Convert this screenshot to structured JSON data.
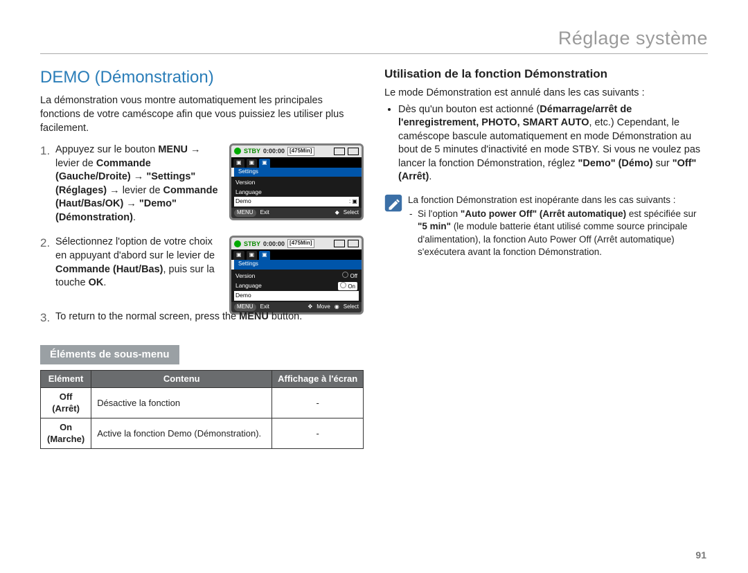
{
  "header": {
    "title": "Réglage système"
  },
  "page_number": "91",
  "left": {
    "section_title": "DEMO (Démonstration)",
    "intro": "La démonstration vous montre automatiquement les principales fonctions de votre caméscope afin que vous puissiez les utiliser plus facilement.",
    "step1": {
      "pre": "Appuyez sur le bouton ",
      "menu": "MENU",
      "a1": " → levier de ",
      "cmd1": "Commande (Gauche/Droite)",
      "a2": " → ",
      "settings": "\"Settings\" (Réglages)",
      "a3": " → levier de ",
      "cmd2": "Commande (Haut/Bas/OK)",
      "a4": " → ",
      "demo": "\"Demo\" (Démonstration)",
      "end": "."
    },
    "step2": {
      "l1": "Sélectionnez l'option de votre choix en appuyant d'abord sur le levier de ",
      "cmd": "Commande (Haut/Bas)",
      "l2": ", puis sur la touche ",
      "ok": "OK",
      "end": "."
    },
    "step3": {
      "l1": "To return to the normal screen, press the ",
      "menu": "MENU",
      "l2": " button."
    },
    "submenu_title": "Éléments de sous-menu",
    "table": {
      "headers": {
        "c1": "Elément",
        "c2": "Contenu",
        "c3": "Affichage à l'écran"
      },
      "rows": [
        {
          "c1a": "Off",
          "c1b": "(Arrêt)",
          "c2": "Désactive la fonction",
          "c3": "-"
        },
        {
          "c1a": "On",
          "c1b": "(Marche)",
          "c2": "Active la fonction Demo (Démonstration).",
          "c3": "-"
        }
      ]
    }
  },
  "right": {
    "h3": "Utilisation de la fonction Démonstration",
    "lead": "Le mode Démonstration est annulé dans les cas suivants :",
    "bullet": {
      "p1": "Dès qu'un bouton est actionné (",
      "b1": "Démarrage/arrêt de l'enregistrement, PHOTO, SMART AUTO",
      "p2": ", etc.) Cependant, le caméscope bascule automatiquement en mode Démonstration au bout de 5 minutes d'inactivité en mode STBY. Si vous ne voulez pas lancer la fonction Démonstration, réglez ",
      "b2": "\"Demo\" (Démo)",
      "p3": " sur ",
      "b3": "\"Off\" (Arrêt)",
      "p4": "."
    },
    "note_lead": "La fonction Démonstration est inopérante dans les cas suivants :",
    "note_item": {
      "p1": "Si l'option ",
      "b1": "\"Auto power Off\" (Arrêt automatique)",
      "p2": " est spécifiée sur ",
      "b2": "\"5 min\"",
      "p3": " (le module batterie étant utilisé comme source principale d'alimentation), la fonction Auto Power Off (Arrêt automatique) s'exécutera avant la fonction Démonstration."
    }
  },
  "lcd": {
    "stby": "STBY",
    "time": "0:00:00",
    "mins": "[475Min]",
    "tab_label": "Settings",
    "items": {
      "version": "Version",
      "language": "Language",
      "demo": "Demo"
    },
    "vals": {
      "off": "Off",
      "on": "On"
    },
    "footer": {
      "menu": "MENU",
      "exit": "Exit",
      "move": "Move",
      "select": "Select"
    }
  }
}
